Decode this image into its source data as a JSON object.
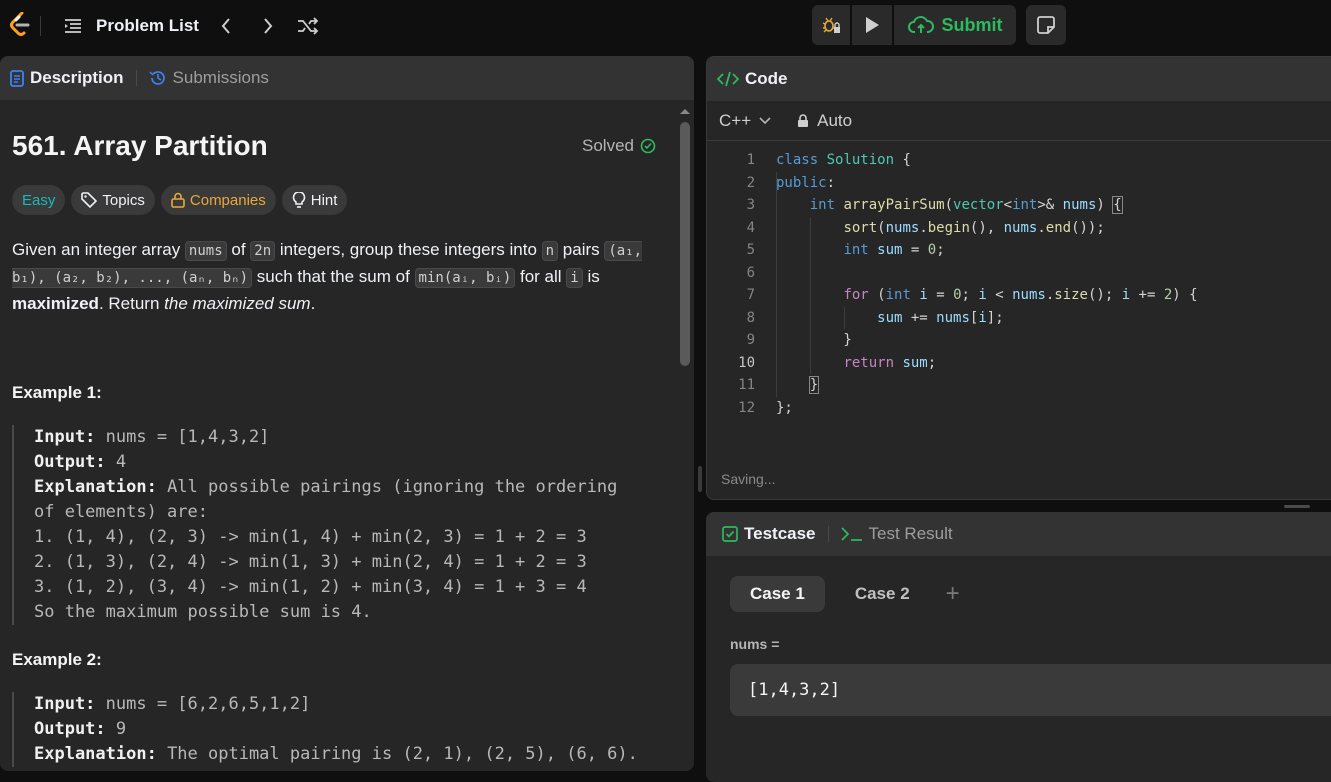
{
  "topbar": {
    "problem_list": "Problem List",
    "submit": "Submit"
  },
  "description_panel": {
    "tabs": [
      {
        "label": "Description",
        "active": true
      },
      {
        "label": "Submissions",
        "active": false
      }
    ],
    "title": "561. Array Partition",
    "status": "Solved",
    "chips": {
      "difficulty": "Easy",
      "topics": "Topics",
      "companies": "Companies",
      "hint": "Hint"
    },
    "statement": {
      "t1": "Given an integer array ",
      "c_nums": "nums",
      "t2": " of ",
      "c_2n": "2n",
      "t3": " integers, group these integers into ",
      "c_n": "n",
      "t4": " pairs ",
      "c_pairs": "(a₁, b₁), (a₂, b₂), ..., (aₙ, bₙ)",
      "t5": " such that the sum of ",
      "c_min": "min(aᵢ, bᵢ)",
      "t6": " for all ",
      "c_i": "i",
      "t7": " is ",
      "bold": "maximized",
      "t8": ". Return ",
      "italic": "the maximized sum",
      "t9": "."
    },
    "examples": [
      {
        "heading": "Example 1:",
        "input_label": "Input:",
        "input": " nums = [1,4,3,2]",
        "output_label": "Output:",
        "output": " 4",
        "explanation_label": "Explanation:",
        "explanation": " All possible pairings (ignoring the ordering",
        "lines": [
          "of elements) are:",
          "1. (1, 4), (2, 3) -> min(1, 4) + min(2, 3) = 1 + 2 = 3",
          "2. (1, 3), (2, 4) -> min(1, 3) + min(2, 4) = 1 + 2 = 3",
          "3. (1, 2), (3, 4) -> min(1, 2) + min(3, 4) = 1 + 3 = 4",
          "So the maximum possible sum is 4."
        ]
      },
      {
        "heading": "Example 2:",
        "input_label": "Input:",
        "input": " nums = [6,2,6,5,1,2]",
        "output_label": "Output:",
        "output": " 9",
        "explanation_label": "Explanation:",
        "explanation": " The optimal pairing is (2, 1), (2, 5), (6, 6)."
      }
    ]
  },
  "code_panel": {
    "tab": "Code",
    "language": "C++",
    "mode": "Auto",
    "line_numbers": [
      "1",
      "2",
      "3",
      "4",
      "5",
      "6",
      "7",
      "8",
      "9",
      "10",
      "11",
      "12"
    ],
    "current_line": 10,
    "status": "Saving..."
  },
  "testcase_panel": {
    "tabs": [
      {
        "label": "Testcase",
        "active": true
      },
      {
        "label": "Test Result",
        "active": false
      }
    ],
    "cases": [
      "Case 1",
      "Case 2"
    ],
    "add": "+",
    "var_label": "nums =",
    "var_value": "[1,4,3,2]"
  },
  "colors": {
    "accent_green": "#2cbb5d",
    "easy": "#1cb8b8",
    "companies": "#e9a93a",
    "tab_blue": "#3b82f6"
  }
}
